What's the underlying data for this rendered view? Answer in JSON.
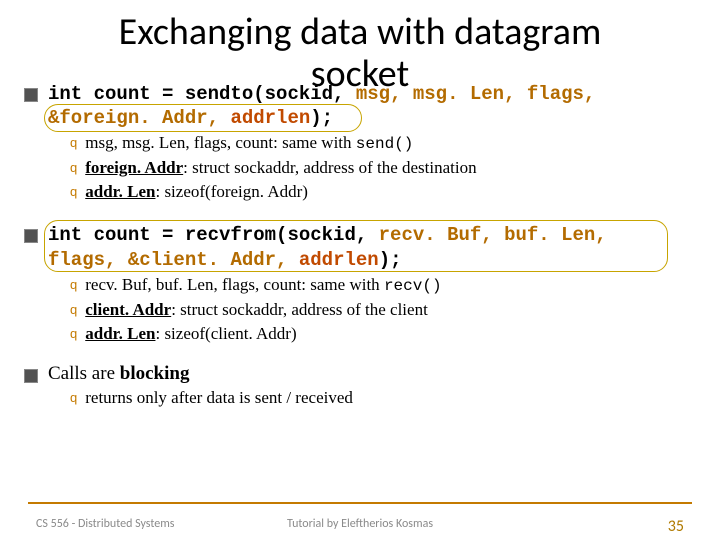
{
  "title_line1": "Exchanging data with datagram",
  "title_line2": "socket",
  "sendto": {
    "pre": "int count = sendto(sockid, ",
    "args1": "msg, msg. Len, flags,",
    "line2a": "&foreign. Addr, ",
    "line2b": "addrlen",
    "line2c": ");",
    "sub": [
      {
        "lead": "msg, msg. Len, flags, count",
        "rest": ": same with ",
        "mono": "send()"
      },
      {
        "lead": "foreign. Addr",
        "rest": ": struct sockaddr, address of the destination"
      },
      {
        "lead": "addr. Len",
        "rest": ": sizeof(foreign. Addr)"
      }
    ]
  },
  "recvfrom": {
    "pre": "int count = recvfrom(sockid, ",
    "args1": "recv. Buf, buf. Len,",
    "line2a": "flags, ",
    "line2b": "&client. Addr, ",
    "line2c": "addrlen",
    "line2d": ");",
    "sub": [
      {
        "lead": "recv. Buf, buf. Len, flags, count",
        "rest": ": same with ",
        "mono": "recv()"
      },
      {
        "lead": "client. Addr",
        "rest": ": struct sockaddr, address of the client"
      },
      {
        "lead": "addr. Len",
        "rest": ": sizeof(client. Addr)"
      }
    ]
  },
  "blocking": {
    "text_a": "Calls are ",
    "text_b": "blocking",
    "sub": "returns only after data is sent / received"
  },
  "footer": {
    "left": "CS 556 - Distributed Systems",
    "center": "Tutorial by Eleftherios Kosmas",
    "page": "35"
  },
  "q_glyph": "q"
}
